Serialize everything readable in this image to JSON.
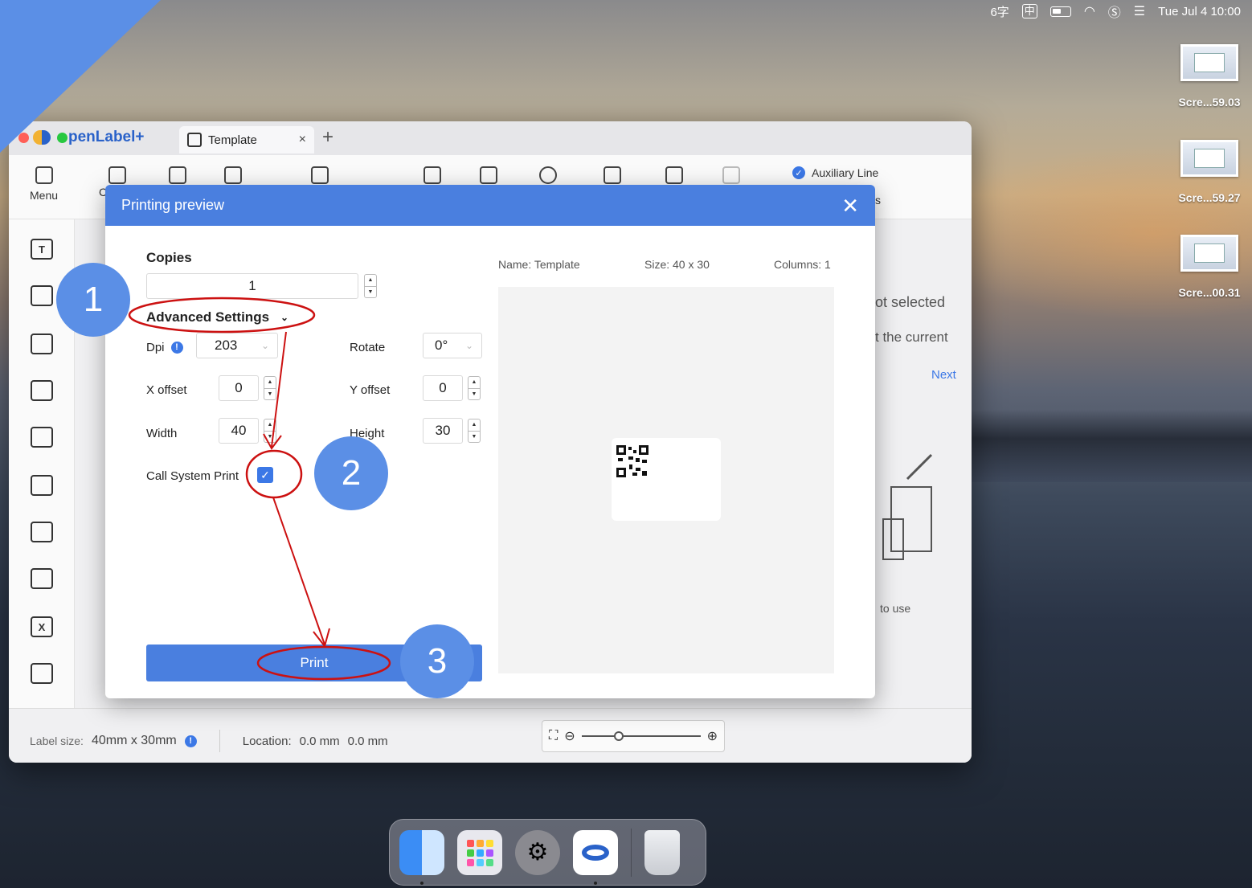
{
  "menubar": {
    "ime_count": "6字",
    "ime_char": "中",
    "datetime": "Tue Jul 4  10:00"
  },
  "desktop": {
    "files": [
      {
        "label": "Scre...59.03"
      },
      {
        "label": "Scre...59.27"
      },
      {
        "label": "Scre...00.31"
      }
    ]
  },
  "app": {
    "name": "penLabel+",
    "tab_label": "Template",
    "tab_close": "×",
    "tab_add": "+",
    "toolbar": {
      "menu_label": "Menu",
      "partial_label": "C",
      "auxiliary_line": "Auxiliary Line",
      "partial_right": "s"
    },
    "sidebar_text_icon": "T",
    "sidebar_x_icon": "X",
    "right_panel": {
      "not_selected": "ot selected",
      "current": "t the current",
      "next": "Next",
      "to_use": "to use"
    },
    "bottom": {
      "label_size_caption": "Label size:",
      "label_size_value": "40mm x 30mm",
      "location_caption": "Location:",
      "location_x": "0.0 mm",
      "location_y": "0.0 mm"
    }
  },
  "dialog": {
    "title": "Printing preview",
    "close": "✕",
    "copies_label": "Copies",
    "copies_value": "1",
    "advanced_label": "Advanced Settings",
    "dpi_label": "Dpi",
    "dpi_value": "203",
    "rotate_label": "Rotate",
    "rotate_value": "0°",
    "x_offset_label": "X offset",
    "x_offset_value": "0",
    "y_offset_label": "Y offset",
    "y_offset_value": "0",
    "width_label": "Width",
    "width_value": "40",
    "height_label": "Height",
    "height_value": "30",
    "system_print_label": "Call System Print",
    "system_print_checked": true,
    "print_button": "Print",
    "preview": {
      "name": "Name: Template",
      "size": "Size: 40 x 30",
      "columns": "Columns: 1"
    }
  },
  "annotations": {
    "steps": [
      "1",
      "2",
      "3"
    ],
    "color": "#cc1111"
  },
  "colors": {
    "accent": "#4a7fdf",
    "step_badge": "#5b8fe6"
  }
}
